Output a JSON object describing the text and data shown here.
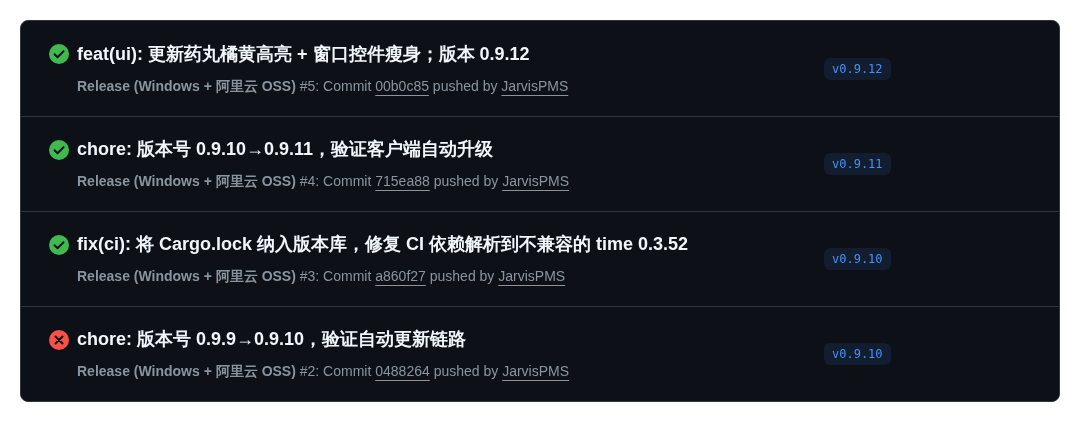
{
  "runs": [
    {
      "failed": false,
      "title": "feat(ui): 更新药丸橘黄高亮 + 窗口控件瘦身；版本 0.9.12",
      "workflow": "Release (Windows + 阿里云 OSS)",
      "run_label": "#5: Commit",
      "commit": "00b0c85",
      "pushed_label": "pushed by",
      "actor": "JarvisPMS",
      "tag": "v0.9.12"
    },
    {
      "failed": false,
      "title": "chore: 版本号 0.9.10→0.9.11，验证客户端自动升级",
      "workflow": "Release (Windows + 阿里云 OSS)",
      "run_label": "#4: Commit",
      "commit": "715ea88",
      "pushed_label": "pushed by",
      "actor": "JarvisPMS",
      "tag": "v0.9.11"
    },
    {
      "failed": false,
      "title": "fix(ci): 将 Cargo.lock 纳入版本库，修复 CI 依赖解析到不兼容的 time 0.3.52",
      "workflow": "Release (Windows + 阿里云 OSS)",
      "run_label": "#3: Commit",
      "commit": "a860f27",
      "pushed_label": "pushed by",
      "actor": "JarvisPMS",
      "tag": "v0.9.10"
    },
    {
      "failed": true,
      "title": "chore: 版本号 0.9.9→0.9.10，验证自动更新链路",
      "workflow": "Release (Windows + 阿里云 OSS)",
      "run_label": "#2: Commit",
      "commit": "0488264",
      "pushed_label": "pushed by",
      "actor": "JarvisPMS",
      "tag": "v0.9.10"
    }
  ]
}
